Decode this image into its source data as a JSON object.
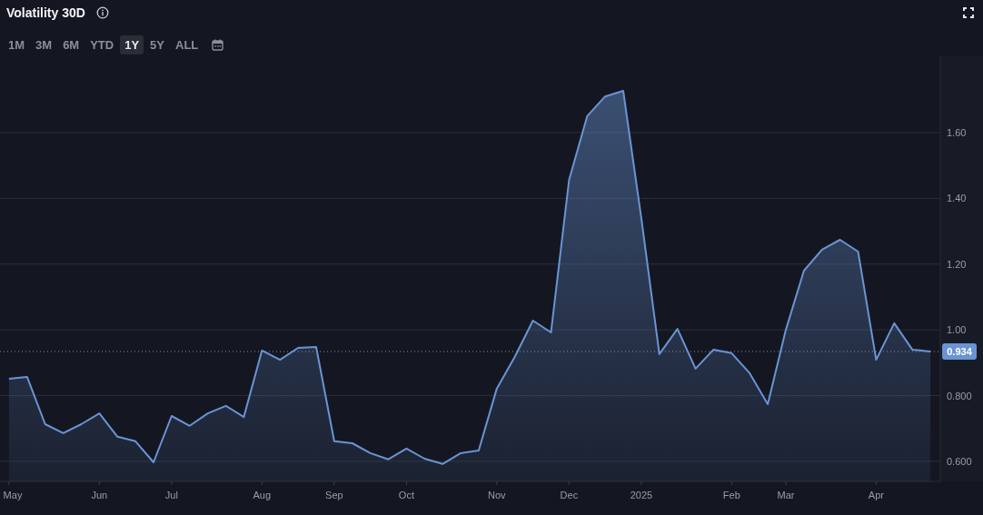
{
  "header": {
    "title": "Volatility 30D"
  },
  "ranges": [
    {
      "label": "1M",
      "selected": false
    },
    {
      "label": "3M",
      "selected": false
    },
    {
      "label": "6M",
      "selected": false
    },
    {
      "label": "YTD",
      "selected": false
    },
    {
      "label": "1Y",
      "selected": true
    },
    {
      "label": "5Y",
      "selected": false
    },
    {
      "label": "ALL",
      "selected": false
    }
  ],
  "chart": {
    "chart_data": {
      "type": "area",
      "grid": true,
      "ref_lines": [
        {
          "axis": "y",
          "value": 0.934,
          "label": "0.934"
        }
      ],
      "ylim": [
        0.539,
        1.832
      ],
      "categories": [
        "May",
        null,
        null,
        null,
        null,
        "Jun",
        null,
        null,
        null,
        "Jul",
        null,
        null,
        null,
        null,
        "Aug",
        null,
        null,
        null,
        "Sep",
        null,
        null,
        null,
        "Oct",
        null,
        null,
        null,
        null,
        "Nov",
        null,
        null,
        null,
        "Dec",
        null,
        null,
        null,
        "2025",
        null,
        null,
        null,
        null,
        "Feb",
        null,
        null,
        "Mar",
        null,
        null,
        null,
        null,
        "Apr",
        null,
        null,
        null
      ],
      "series": [
        {
          "color": "#6a94d4",
          "values": [
            0.851,
            0.857,
            0.713,
            0.686,
            0.713,
            0.746,
            0.675,
            0.661,
            0.597,
            0.738,
            0.708,
            0.746,
            0.769,
            0.735,
            0.937,
            0.909,
            0.945,
            0.948,
            0.661,
            0.655,
            0.625,
            0.606,
            0.639,
            0.608,
            0.592,
            0.625,
            0.633,
            0.821,
            0.918,
            1.028,
            0.992,
            1.456,
            1.65,
            1.71,
            1.727,
            1.34,
            0.926,
            1.003,
            0.882,
            0.94,
            0.929,
            0.868,
            0.774,
            1.0,
            1.18,
            1.244,
            1.274,
            1.238,
            0.909,
            1.02,
            0.94,
            0.934
          ]
        }
      ],
      "yticks": [
        {
          "value": 0.6,
          "label": "0.600"
        },
        {
          "value": 0.8,
          "label": "0.800"
        },
        {
          "value": 1.0,
          "label": "1.00"
        },
        {
          "value": 1.2,
          "label": "1.20"
        },
        {
          "value": 1.4,
          "label": "1.40"
        },
        {
          "value": 1.6,
          "label": "1.60"
        }
      ]
    }
  }
}
